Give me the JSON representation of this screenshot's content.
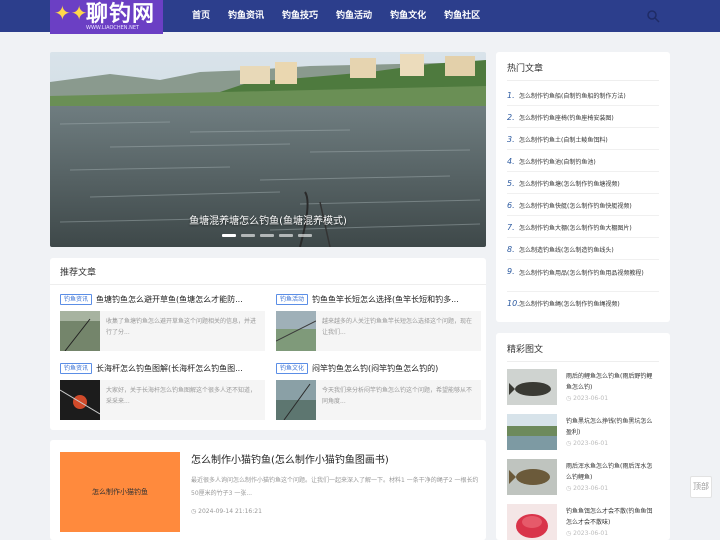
{
  "header": {
    "logo_text": "聊钓网",
    "logo_sub": "WWW.LIAOCHEN.NET",
    "nav": [
      "首页",
      "钓鱼资讯",
      "钓鱼技巧",
      "钓鱼活动",
      "钓鱼文化",
      "钓鱼社区"
    ]
  },
  "slider": {
    "caption": "鱼塘混养塘怎么钓鱼(鱼塘混养模式)",
    "dots": 5,
    "active_dot": 0
  },
  "recommended": {
    "title": "推荐文章",
    "items": [
      {
        "tag": "钓鱼资讯",
        "title": "鱼塘钓鱼怎么避开草鱼(鱼塘怎么才能防...",
        "desc": "收集了鱼塘钓鱼怎么避开草鱼这个问题相关的信息，并进行了分..."
      },
      {
        "tag": "钓鱼活动",
        "title": "钓鱼鱼竿长短怎么选择(鱼竿长短和钓多...",
        "desc": "越来越多的人关注钓鱼鱼竿长短怎么选择这个问题，现在让我们..."
      },
      {
        "tag": "钓鱼资讯",
        "title": "长海杆怎么钓鱼图解(长海杆怎么钓鱼图...",
        "desc": "大家好，关于长海杆怎么钓鱼图解这个很多人还不知道，采采来..."
      },
      {
        "tag": "钓鱼文化",
        "title": "闷竿钓鱼怎么钓(闷竿钓鱼怎么钓的)",
        "desc": "今天我们来分析闷竿钓鱼怎么钓这个问题，希望能够从不同角度..."
      }
    ]
  },
  "feature": {
    "image_label": "怎么制作小猫钓鱼",
    "title": "怎么制作小猫钓鱼(怎么制作小猫钓鱼图画书)",
    "desc": "最近很多人询问怎么制作小猫钓鱼这个问题。让我们一起来深入了解一下。材料1 一条干净的绳子2 一根长约50厘米的竹子3 一张...",
    "time": "2024-09-14 21:16:21"
  },
  "hot": {
    "title": "热门文章",
    "items": [
      {
        "num": "1.",
        "text": "怎么制作钓鱼船(自制钓鱼船的制作方法)"
      },
      {
        "num": "2.",
        "text": "怎么制作钓鱼座椅(钓鱼座椅安装图)"
      },
      {
        "num": "3.",
        "text": "怎么制作钓鱼土(自制土鲮鱼饵料)"
      },
      {
        "num": "4.",
        "text": "怎么制作钓鱼池(自制钓鱼池)"
      },
      {
        "num": "5.",
        "text": "怎么制作钓鱼塘(怎么制作钓鱼塘视频)"
      },
      {
        "num": "6.",
        "text": "怎么制作钓鱼快艇(怎么制作钓鱼快艇视频)"
      },
      {
        "num": "7.",
        "text": "怎么制作钓鱼大棚(怎么制作钓鱼大棚图片)"
      },
      {
        "num": "8.",
        "text": "怎么制造钓鱼线(怎么制造钓鱼线头)"
      },
      {
        "num": "9.",
        "text": "怎么制作钓鱼用品(怎么制作钓鱼用品视频教程)"
      },
      {
        "num": "10.",
        "text": "怎么制作钓鱼绳(怎么制作钓鱼绳视频)"
      }
    ]
  },
  "pics": {
    "title": "精彩图文",
    "items": [
      {
        "title": "雨后的鲤鱼怎么钓鱼(雨后野钓鲤鱼怎么钓)",
        "date": "2023-06-01"
      },
      {
        "title": "钓鱼黑坑怎么挣钱(钓鱼黑坑怎么盈利)",
        "date": "2023-06-01"
      },
      {
        "title": "雨后浑水鱼怎么钓鱼(雨后浑水怎么钓鲤鱼)",
        "date": "2023-06-01"
      },
      {
        "title": "钓鱼鱼饵怎么才会不散(钓鱼鱼饵怎么才会不散味)",
        "date": "2023-06-01"
      }
    ]
  },
  "float_btn": "顶部"
}
